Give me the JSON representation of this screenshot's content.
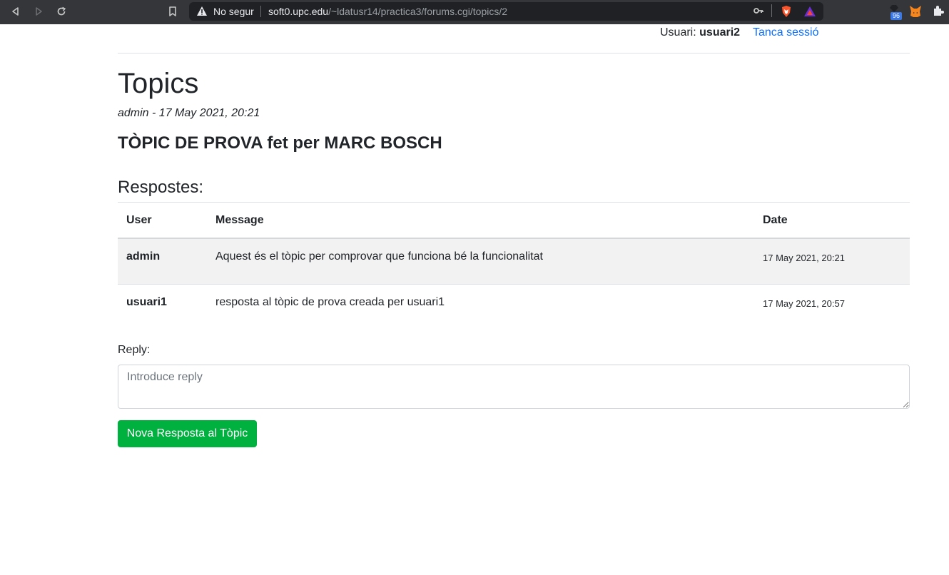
{
  "browser": {
    "not_secure_label": "No segur",
    "url_host": "soft0.upc.edu",
    "url_path": "/~ldatusr14/practica3/forums.cgi/topics/2",
    "extension_badge": "96",
    "icons": [
      "back-icon",
      "forward-icon",
      "reload-icon",
      "bookmark-icon",
      "warning-icon",
      "key-icon",
      "brave-shield-icon",
      "brave-rewards-icon",
      "extension-icon",
      "metamask-icon",
      "puzzle-icon"
    ]
  },
  "header": {
    "user_prefix": "Usuari:",
    "username": "usuari2",
    "logout_label": "Tanca sessió"
  },
  "page": {
    "title": "Topics",
    "meta": "admin - 17 May 2021, 20:21",
    "topic_title": "TÒPIC DE PROVA fet per MARC BOSCH",
    "replies_heading": "Respostes:"
  },
  "table": {
    "headers": {
      "user": "User",
      "message": "Message",
      "date": "Date"
    },
    "rows": [
      {
        "user": "admin",
        "message": "Aquest és el tòpic per comprovar que funciona bé la funcionalitat",
        "date": "17 May 2021, 20:21"
      },
      {
        "user": "usuari1",
        "message": "resposta al tòpic de prova creada per usuari1",
        "date": "17 May 2021, 20:57"
      }
    ]
  },
  "form": {
    "reply_label": "Reply:",
    "reply_placeholder": "Introduce reply",
    "reply_value": "",
    "submit_label": "Nova Resposta al Tòpic"
  },
  "colors": {
    "browser_bar": "#35363a",
    "link": "#0d6efd",
    "submit_button": "#00b140",
    "row_stripe": "#f2f2f2"
  }
}
